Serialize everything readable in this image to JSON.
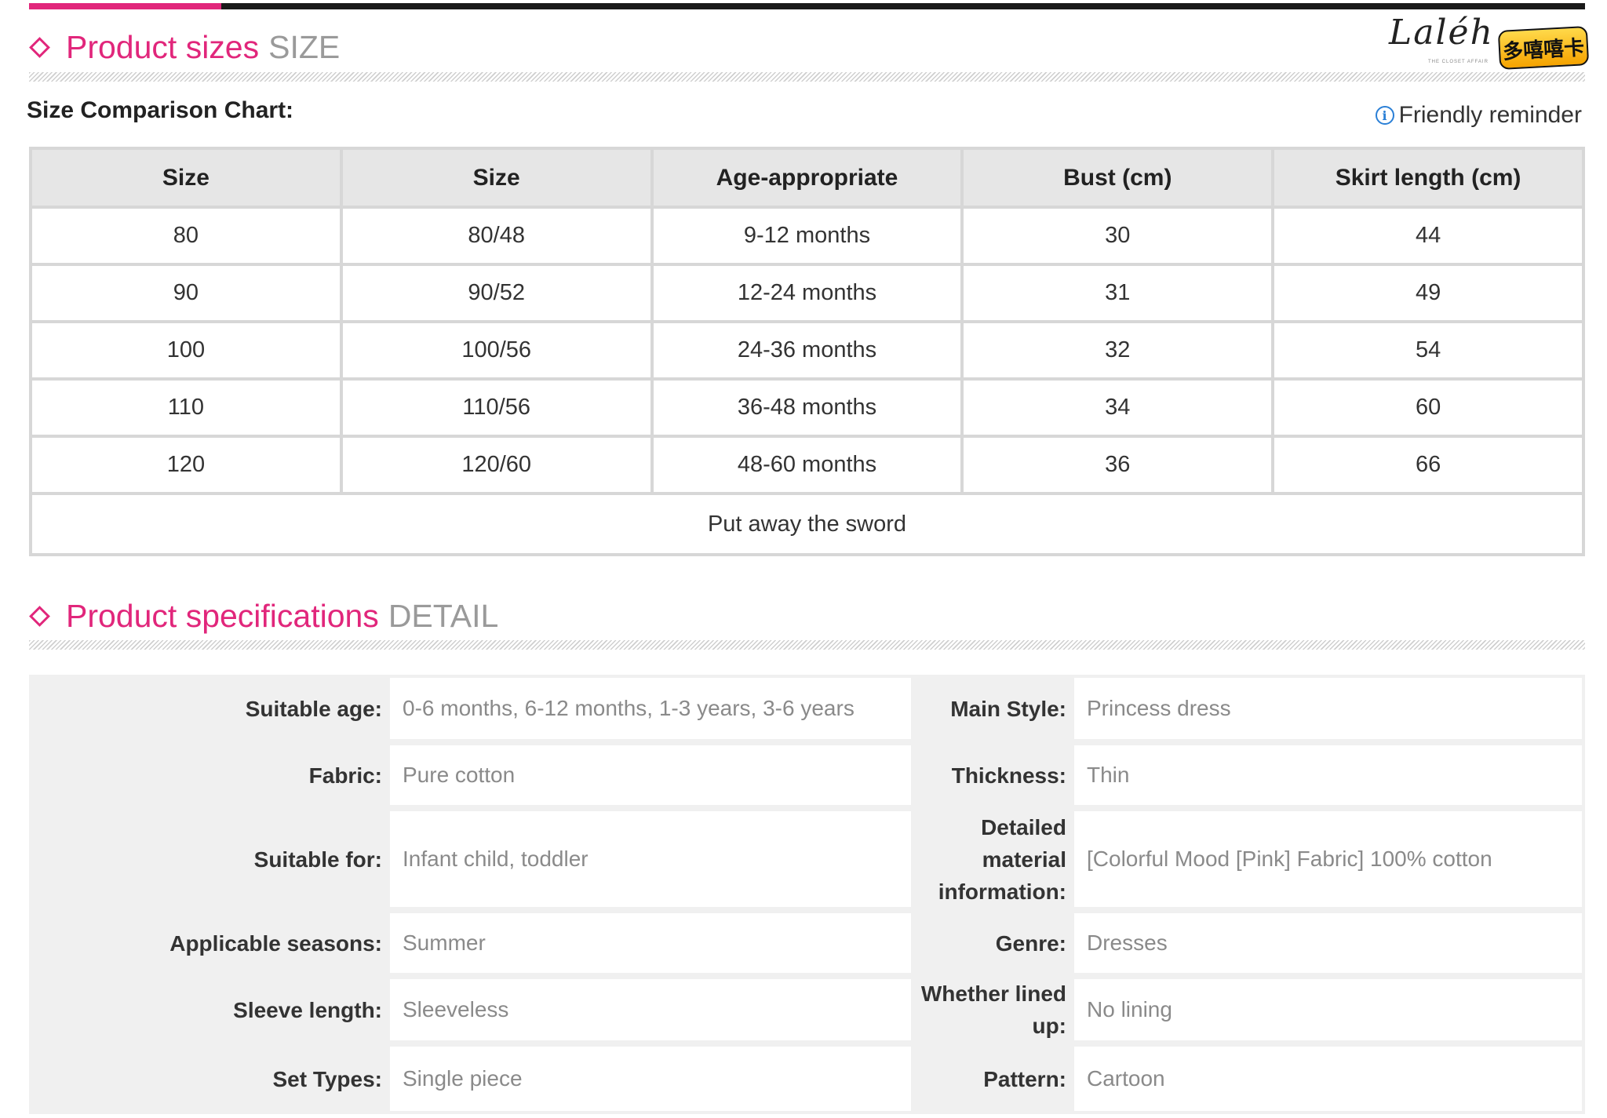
{
  "sizes_section": {
    "title": "Product sizes",
    "title_en": "SIZE",
    "chart_title": "Size Comparison Chart:",
    "reminder": "Friendly reminder",
    "headers": [
      "Size",
      "Size",
      "Age-appropriate",
      "Bust (cm)",
      "Skirt length (cm)"
    ],
    "rows": [
      [
        "80",
        "80/48",
        "9-12 months",
        "30",
        "44"
      ],
      [
        "90",
        "90/52",
        "12-24 months",
        "31",
        "49"
      ],
      [
        "100",
        "100/56",
        "24-36 months",
        "32",
        "54"
      ],
      [
        "110",
        "110/56",
        "36-48 months",
        "34",
        "60"
      ],
      [
        "120",
        "120/60",
        "48-60 months",
        "36",
        "66"
      ]
    ],
    "footer": "Put away the sword"
  },
  "logo": {
    "script": "Laléh",
    "sub": "THE CLOSET AFFAIR",
    "badge": "多嘻嘻卡"
  },
  "spec_section": {
    "title": "Product specifications",
    "title_en": "DETAIL",
    "rows": [
      {
        "l1": "Suitable age:",
        "v1": "0-6 months, 6-12 months, 1-3 years, 3-6 years",
        "l2": "Main Style:",
        "v2": "Princess dress"
      },
      {
        "l1": "Fabric:",
        "v1": "Pure cotton",
        "l2": "Thickness:",
        "v2": "Thin"
      },
      {
        "l1": "Suitable for:",
        "v1": "Infant child, toddler",
        "l2": "Detailed material information:",
        "v2": "[Colorful Mood [Pink] Fabric] 100% cotton"
      },
      {
        "l1": "Applicable seasons:",
        "v1": "Summer",
        "l2": "Genre:",
        "v2": "Dresses"
      },
      {
        "l1": "Sleeve length:",
        "v1": "Sleeveless",
        "l2": "Whether lined up:",
        "v2": "No lining"
      },
      {
        "l1": "Set Types:",
        "v1": "Single piece",
        "l2": "Pattern:",
        "v2": "Cartoon"
      }
    ]
  },
  "colors": {
    "accent": "#e1267b",
    "muted": "#9a9a9a",
    "info": "#2a7fd6"
  }
}
